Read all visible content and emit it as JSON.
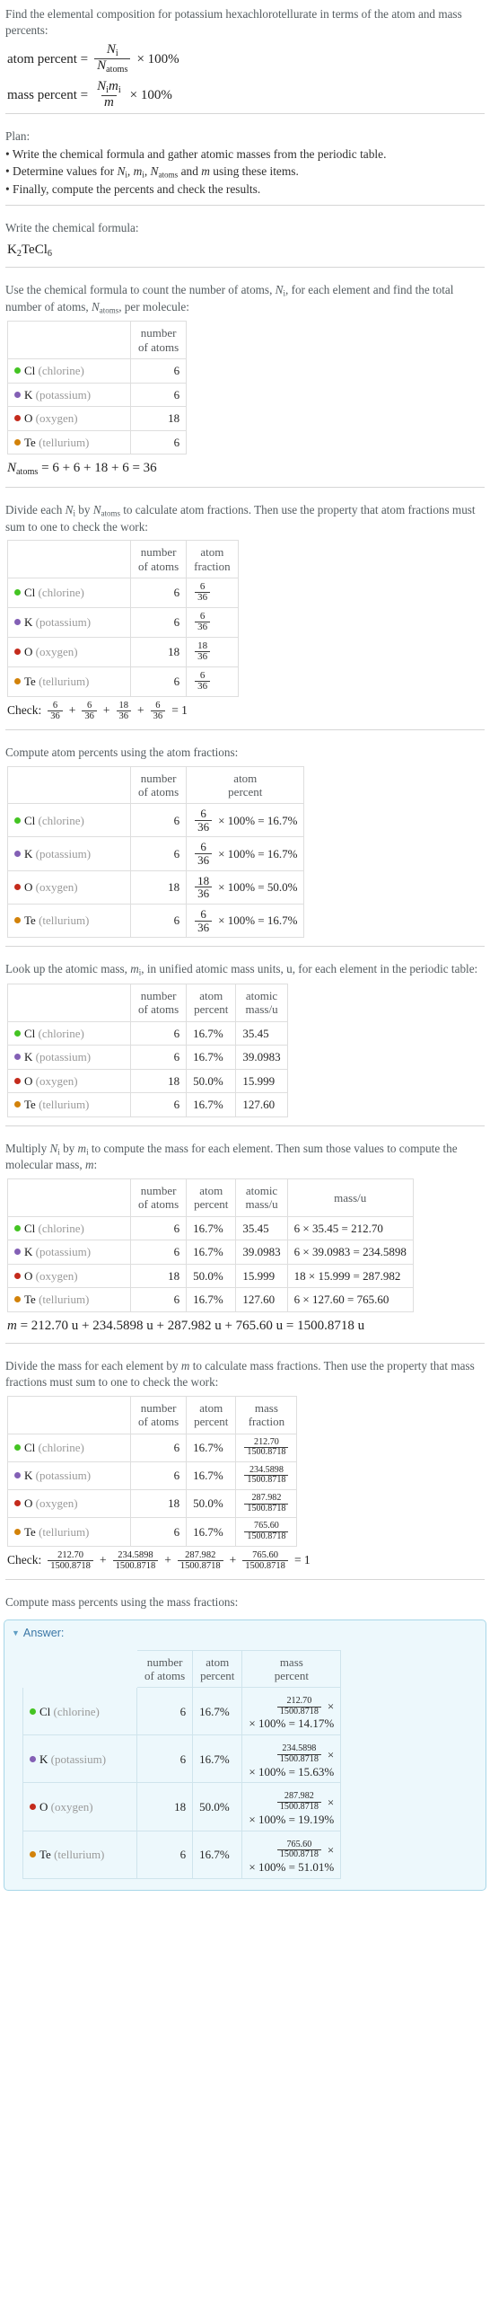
{
  "intro": {
    "question": "Find the elemental composition for potassium hexachlorotellurate in terms of the atom and mass percents:",
    "atom_percent_label": "atom percent =",
    "mass_percent_label": "mass percent =",
    "times100": "× 100%"
  },
  "plan": {
    "title": "Plan:",
    "steps": [
      "Write the chemical formula and gather atomic masses from the periodic table.",
      "Determine values for Nᵢ, mᵢ, Nₐₜₒₘₛ and m using these items.",
      "Finally, compute the percents and check the results."
    ]
  },
  "formula_section": {
    "prompt": "Write the chemical formula:",
    "formula": "K2TeCl6"
  },
  "count_section": {
    "prompt": "Use the chemical formula to count the number of atoms, Nᵢ, for each element and find the total number of atoms, Nₐₜₒₘₛ, per molecule:",
    "headers": [
      "",
      "number of atoms"
    ],
    "total_line": "Nₐₜₒₘₛ = 6 + 6 + 18 + 6 = 36"
  },
  "fraction_section": {
    "prompt": "Divide each Nᵢ by Nₐₜₒₘₛ to calculate atom fractions. Then use the property that atom fractions must sum to one to check the work:",
    "headers": [
      "",
      "number of atoms",
      "atom fraction"
    ],
    "check_label": "Check:",
    "check_result": "= 1"
  },
  "atom_percent_section": {
    "prompt": "Compute atom percents using the atom fractions:",
    "headers": [
      "",
      "number of atoms",
      "atom percent"
    ]
  },
  "atomic_mass_section": {
    "prompt": "Look up the atomic mass, mᵢ, in unified atomic mass units, u, for each element in the periodic table:",
    "headers": [
      "",
      "number of atoms",
      "atom percent",
      "atomic mass/u"
    ]
  },
  "mass_section": {
    "prompt": "Multiply Nᵢ by mᵢ to compute the mass for each element. Then sum those values to compute the molecular mass, m:",
    "headers": [
      "",
      "number of atoms",
      "atom percent",
      "atomic mass/u",
      "mass/u"
    ],
    "total_line": "m = 212.70 u + 234.5898 u + 287.982 u + 765.60 u = 1500.8718 u"
  },
  "mass_fraction_section": {
    "prompt": "Divide the mass for each element by m to calculate mass fractions. Then use the property that mass fractions must sum to one to check the work:",
    "headers": [
      "",
      "number of atoms",
      "atom percent",
      "mass fraction"
    ],
    "check_label": "Check:",
    "check_result": "= 1"
  },
  "answer_section": {
    "prompt": "Compute mass percents using the mass fractions:",
    "answer_label": "Answer:",
    "headers": [
      "",
      "number of atoms",
      "atom percent",
      "mass percent"
    ]
  },
  "total_mass": "1500.8718",
  "total_atoms": "36",
  "elements": [
    {
      "symbol": "Cl",
      "name": "(chlorine)",
      "color": "#44c423",
      "count": "6",
      "atom_fraction_num": "6",
      "atom_fraction_den": "36",
      "atom_percent": "16.7%",
      "atom_percent_expr": "× 100% = 16.7%",
      "atomic_mass": "35.45",
      "mass_expr": "6 × 35.45 = 212.70",
      "mass": "212.70",
      "mass_fraction_num": "212.70",
      "mass_fraction_den": "1500.8718",
      "mass_percent_line1": "× 100% = 14.17%",
      "mass_percent": "14.17%"
    },
    {
      "symbol": "K",
      "name": "(potassium)",
      "color": "#8360b5",
      "count": "6",
      "atom_fraction_num": "6",
      "atom_fraction_den": "36",
      "atom_percent": "16.7%",
      "atom_percent_expr": "× 100% = 16.7%",
      "atomic_mass": "39.0983",
      "mass_expr": "6 × 39.0983 = 234.5898",
      "mass": "234.5898",
      "mass_fraction_num": "234.5898",
      "mass_fraction_den": "1500.8718",
      "mass_percent_line1": "× 100% = 15.63%",
      "mass_percent": "15.63%"
    },
    {
      "symbol": "O",
      "name": "(oxygen)",
      "color": "#c42b1c",
      "count": "18",
      "atom_fraction_num": "18",
      "atom_fraction_den": "36",
      "atom_percent": "50.0%",
      "atom_percent_expr": "× 100% = 50.0%",
      "atomic_mass": "15.999",
      "mass_expr": "18 × 15.999 = 287.982",
      "mass": "287.982",
      "mass_fraction_num": "287.982",
      "mass_fraction_den": "1500.8718",
      "mass_percent_line1": "× 100% = 19.19%",
      "mass_percent": "19.19%"
    },
    {
      "symbol": "Te",
      "name": "(tellurium)",
      "color": "#d2820a",
      "count": "6",
      "atom_fraction_num": "6",
      "atom_fraction_den": "36",
      "atom_percent": "16.7%",
      "atom_percent_expr": "× 100% = 16.7%",
      "atomic_mass": "127.60",
      "mass_expr": "6 × 127.60 = 765.60",
      "mass": "765.60",
      "mass_fraction_num": "765.60",
      "mass_fraction_den": "1500.8718",
      "mass_percent_line1": "× 100% = 51.01%",
      "mass_percent": "51.01%"
    }
  ]
}
